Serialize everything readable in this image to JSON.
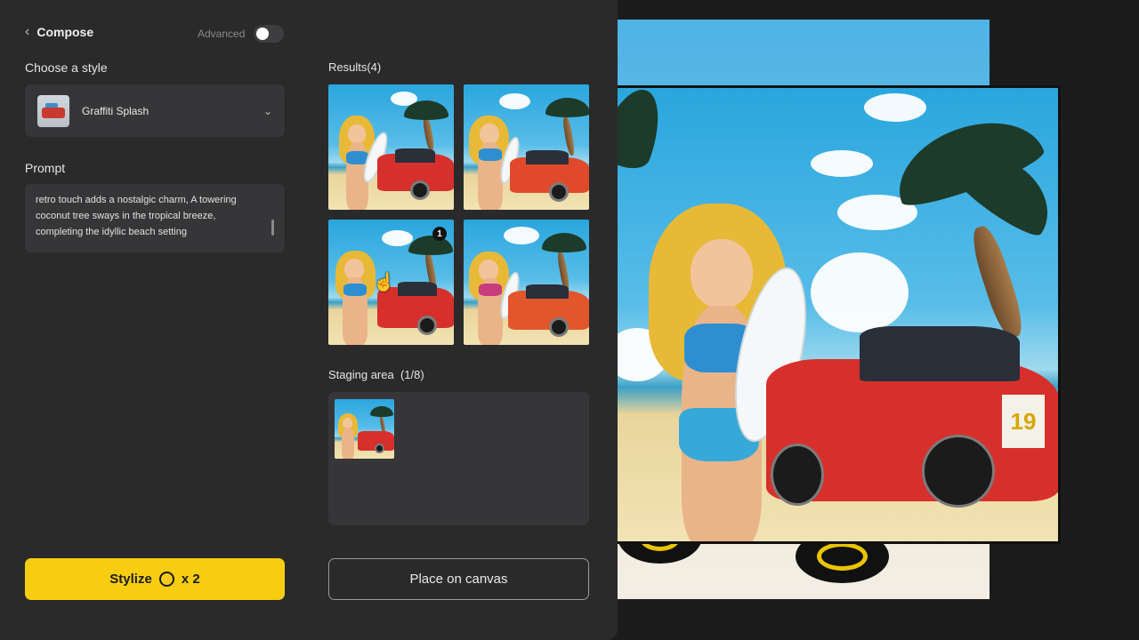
{
  "header": {
    "back_label": "Compose",
    "advanced_label": "Advanced",
    "advanced_enabled": false
  },
  "style": {
    "section_label": "Choose a style",
    "selected": "Graffiti Splash"
  },
  "prompt": {
    "section_label": "Prompt",
    "text": "retro touch adds a nostalgic charm, A towering coconut tree sways in the tropical breeze, completing the idyllic beach setting"
  },
  "stylize_button": {
    "label": "Stylize",
    "cost": "x 2"
  },
  "results": {
    "label": "Results(4)",
    "selected_badge": "1"
  },
  "staging": {
    "label": "Staging area  (1/8)"
  },
  "place_button": {
    "label": "Place on canvas"
  },
  "car_number": "19"
}
